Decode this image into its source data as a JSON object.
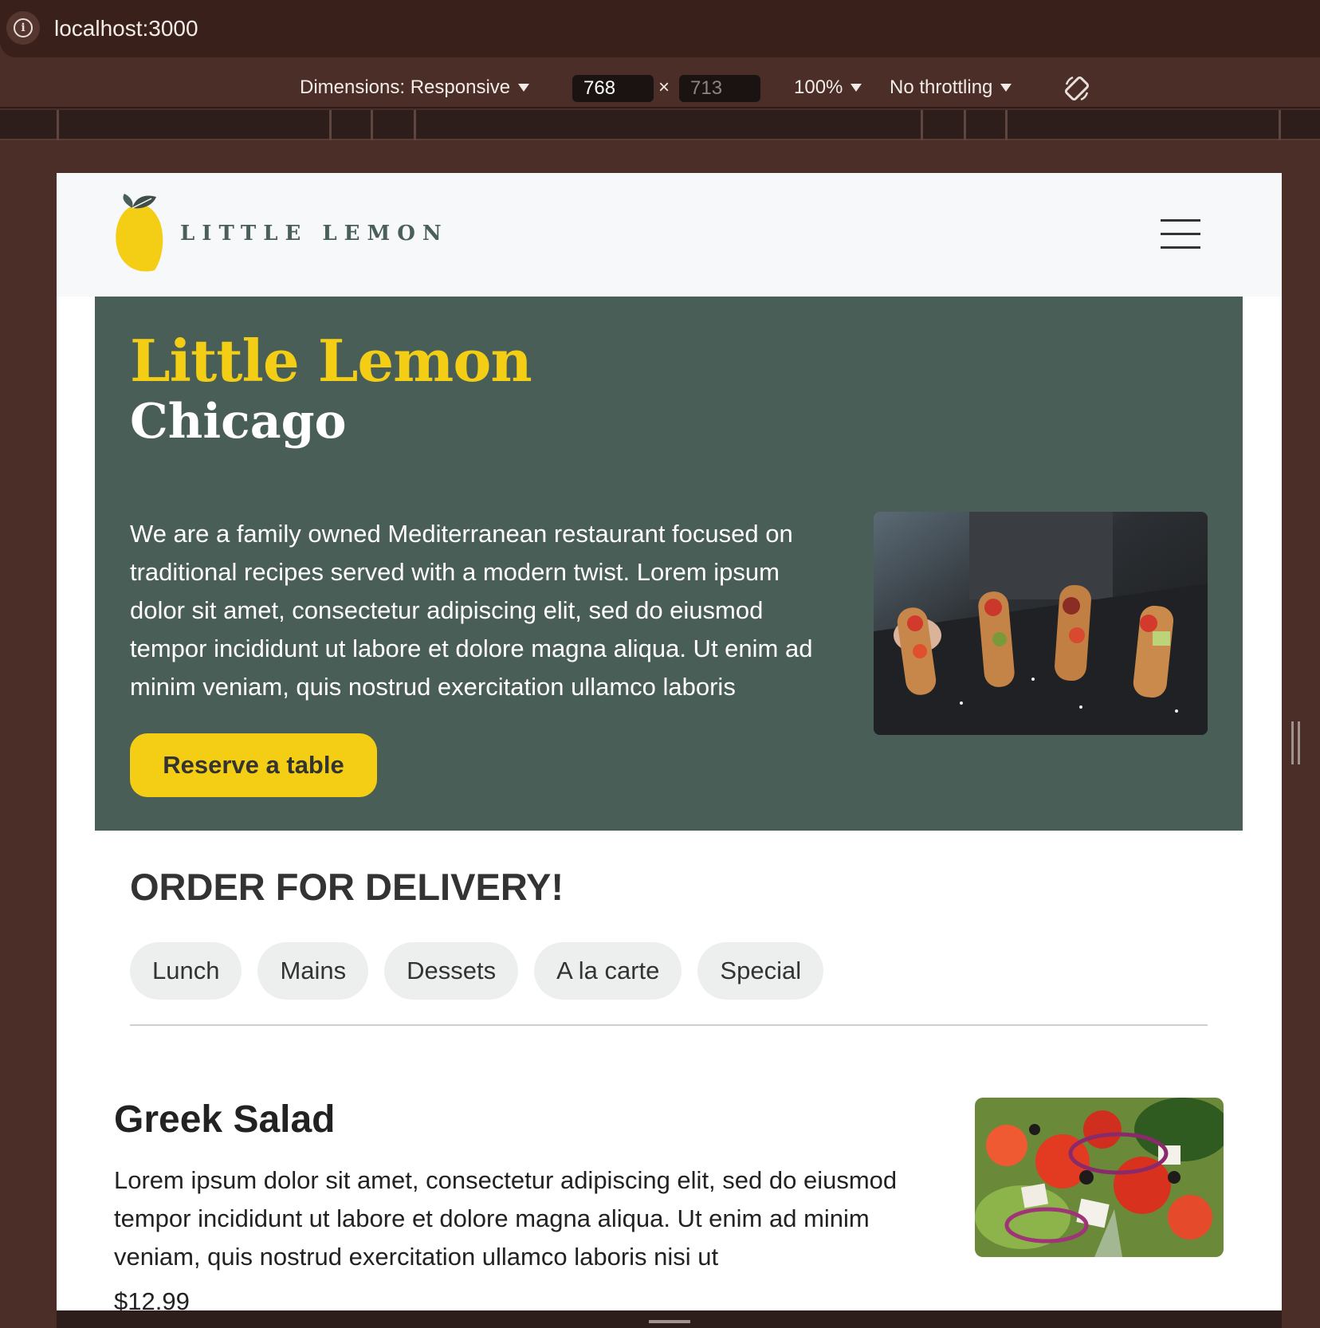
{
  "browser": {
    "url": "localhost:3000",
    "device_toolbar": {
      "dimensions_label": "Dimensions: Responsive",
      "width": "768",
      "height": "713",
      "times": "×",
      "zoom": "100%",
      "throttling": "No throttling"
    }
  },
  "header": {
    "logo_text": "LITTLE LEMON"
  },
  "hero": {
    "title": "Little Lemon",
    "subtitle": "Chicago",
    "description": "We are a family owned Mediterranean restaurant focused on traditional recipes served with a modern twist. Lorem ipsum dolor sit amet, consectetur adipiscing elit, sed do eiusmod tempor incididunt ut labore et dolore magna aliqua. Ut enim ad minim veniam, quis nostrud exercitation ullamco laboris",
    "cta_label": "Reserve a table"
  },
  "order": {
    "title": "ORDER FOR DELIVERY!",
    "categories": [
      "Lunch",
      "Mains",
      "Dessets",
      "A la carte",
      "Special"
    ]
  },
  "menu": {
    "items": [
      {
        "name": "Greek Salad",
        "description": "Lorem ipsum dolor sit amet, consectetur adipiscing elit, sed do eiusmod tempor incididunt ut labore et dolore magna aliqua. Ut enim ad minim veniam, quis nostrud exercitation ullamco laboris nisi ut",
        "price": "$12.99"
      }
    ]
  },
  "colors": {
    "primary_green": "#495e57",
    "primary_yellow": "#f4ce14",
    "pill_bg": "#edefee",
    "browser_chrome": "#3a201b"
  },
  "icons": [
    "info-icon",
    "caret-down-icon",
    "rotate-icon",
    "lemon-logo-icon",
    "hamburger-menu-icon"
  ]
}
